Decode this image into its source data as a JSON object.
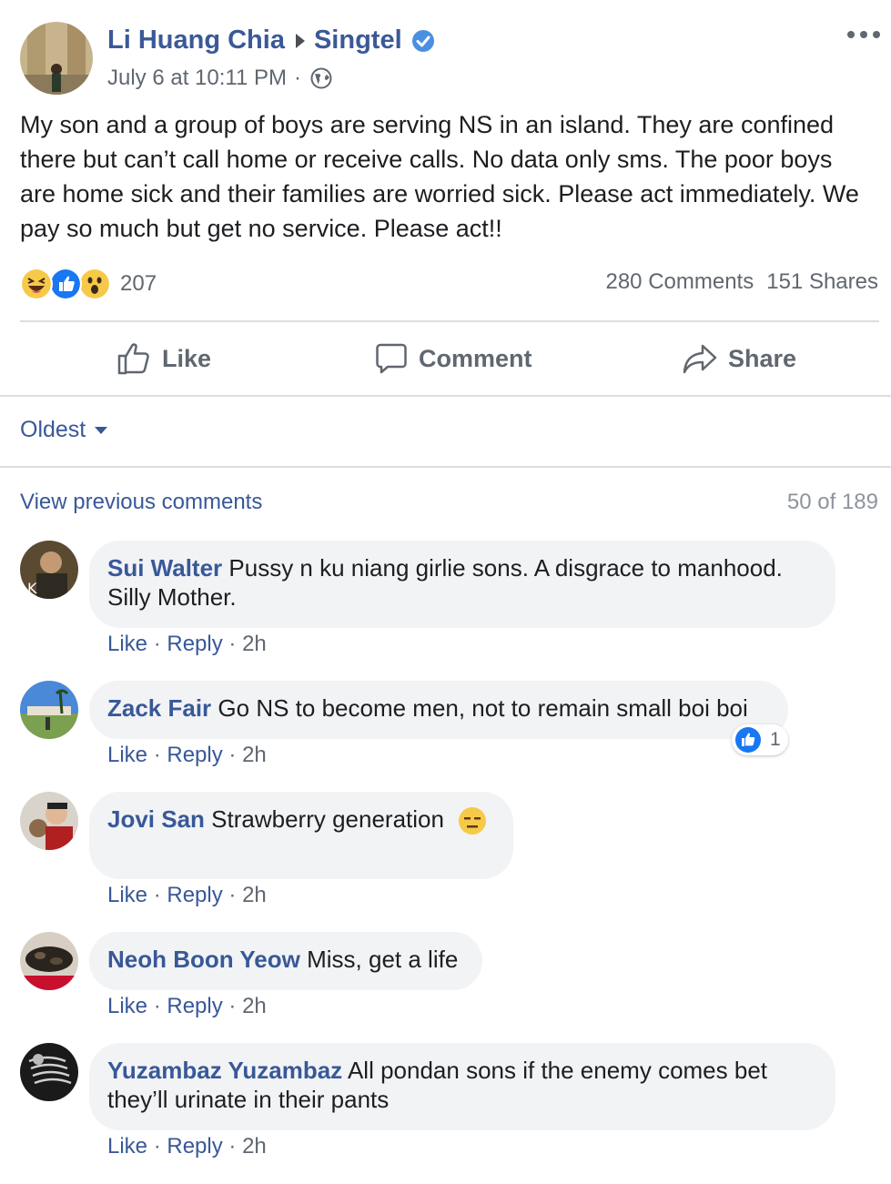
{
  "post": {
    "author": "Li Huang Chia",
    "page": "Singtel",
    "timestamp": "July 6 at 10:11 PM",
    "separator": "·",
    "body": "My son and a group of boys are serving NS in an island. They are confined there but can’t call home or receive calls. No data only sms. The poor boys are home sick and their families are worried sick. Please act immediately. We pay so much but get no service. Please act!!",
    "reaction_count": "207",
    "comments_count": "280 Comments",
    "shares_count": "151 Shares"
  },
  "actions": {
    "like": "Like",
    "comment": "Comment",
    "share": "Share"
  },
  "sort": {
    "label": "Oldest"
  },
  "comments_header": {
    "view_previous": "View previous comments",
    "count": "50 of 189"
  },
  "comments": [
    {
      "name": "Sui Walter",
      "text": "Pussy n ku niang girlie sons. A disgrace to manhood. Silly Mother.",
      "like": "Like",
      "reply": "Reply",
      "time": "2h"
    },
    {
      "name": "Zack Fair",
      "text": "Go NS to become men, not to remain small boi boi",
      "like": "Like",
      "reply": "Reply",
      "time": "2h",
      "likes": "1"
    },
    {
      "name": "Jovi San",
      "text": "Strawberry generation",
      "like": "Like",
      "reply": "Reply",
      "time": "2h"
    },
    {
      "name": "Neoh Boon Yeow",
      "text": "Miss, get a life",
      "like": "Like",
      "reply": "Reply",
      "time": "2h"
    },
    {
      "name": "Yuzambaz Yuzambaz",
      "text": "All pondan sons if the enemy comes bet they’ll urinate in their pants",
      "like": "Like",
      "reply": "Reply",
      "time": "2h"
    }
  ],
  "colors": {
    "link": "#385898",
    "author": "#3b5998",
    "muted": "#606770",
    "bubble": "#f2f3f5",
    "like_blue": "#1877f2"
  },
  "icons": [
    "verified-badge-icon",
    "globe-icon",
    "more-options-icon",
    "haha-reaction-icon",
    "like-reaction-icon",
    "wow-reaction-icon",
    "thumbs-up-icon",
    "comment-bubble-icon",
    "share-arrow-icon",
    "caret-down-icon",
    "expressionless-emoji-icon"
  ]
}
